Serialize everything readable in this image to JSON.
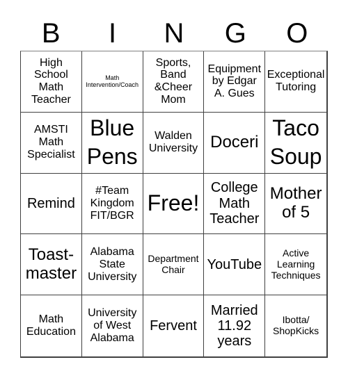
{
  "header": {
    "letters": [
      "B",
      "I",
      "N",
      "G",
      "O"
    ]
  },
  "board": {
    "cells": [
      {
        "text": "High\nSchool\nMath\nTeacher",
        "size": "s-md"
      },
      {
        "text": "Math\nIntervention/Coach",
        "size": "s-xs"
      },
      {
        "text": "Sports,\nBand\n&Cheer\nMom",
        "size": "s-md"
      },
      {
        "text": "Equipment\nby Edgar\nA. Gues",
        "size": "s-md"
      },
      {
        "text": "Exceptional\nTutoring",
        "size": "s-md"
      },
      {
        "text": "AMSTI\nMath\nSpecialist",
        "size": "s-md"
      },
      {
        "text": "Blue\nPens",
        "size": "s-xxl"
      },
      {
        "text": "Walden\nUniversity",
        "size": "s-md"
      },
      {
        "text": "Doceri",
        "size": "s-xl"
      },
      {
        "text": "Taco\nSoup",
        "size": "s-xxl"
      },
      {
        "text": "Remind",
        "size": "s-lg"
      },
      {
        "text": "#Team\nKingdom\nFIT/BGR",
        "size": "s-md"
      },
      {
        "text": "Free!",
        "size": "s-free"
      },
      {
        "text": "College\nMath\nTeacher",
        "size": "s-lg"
      },
      {
        "text": "Mother\nof 5",
        "size": "s-xl"
      },
      {
        "text": "Toast-\nmaster",
        "size": "s-xl"
      },
      {
        "text": "Alabama\nState\nUniversity",
        "size": "s-md"
      },
      {
        "text": "Department\nChair",
        "size": "s-sm"
      },
      {
        "text": "YouTube",
        "size": "s-lg"
      },
      {
        "text": "Active\nLearning\nTechniques",
        "size": "s-sm"
      },
      {
        "text": "Math\nEducation",
        "size": "s-md"
      },
      {
        "text": "University\nof West\nAlabama",
        "size": "s-md"
      },
      {
        "text": "Fervent",
        "size": "s-lg"
      },
      {
        "text": "Married\n11.92\nyears",
        "size": "s-lg"
      },
      {
        "text": "Ibotta/\nShopKicks",
        "size": "s-sm"
      }
    ]
  },
  "colors": {
    "grid_line": "#404040",
    "text": "#000000",
    "background": "#ffffff"
  }
}
